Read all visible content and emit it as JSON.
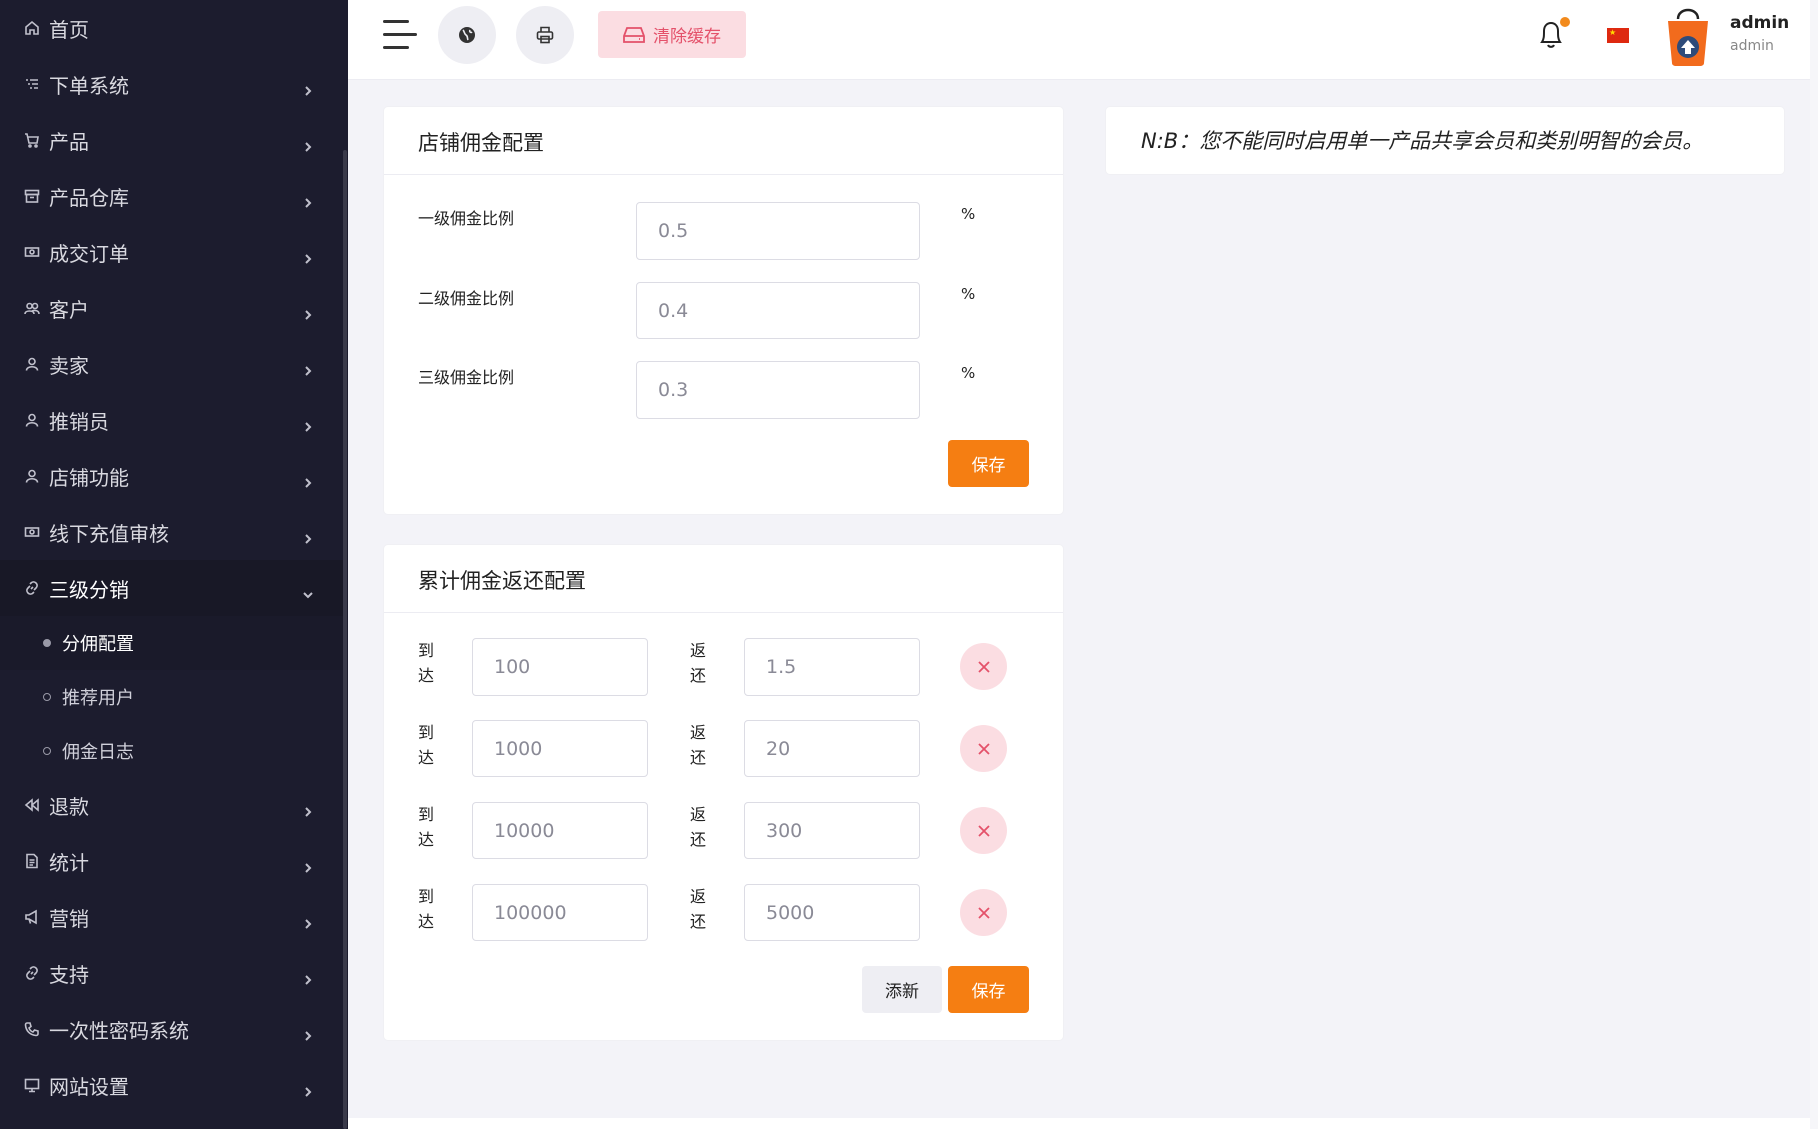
{
  "sidebar": {
    "items": [
      {
        "label": "首页",
        "icon": "home-icon",
        "has_chevron": false
      },
      {
        "label": "下单系统",
        "icon": "list-icon",
        "has_chevron": true
      },
      {
        "label": "产品",
        "icon": "cart-icon",
        "has_chevron": true
      },
      {
        "label": "产品仓库",
        "icon": "archive-icon",
        "has_chevron": true
      },
      {
        "label": "成交订单",
        "icon": "money-icon",
        "has_chevron": true
      },
      {
        "label": "客户",
        "icon": "users-icon",
        "has_chevron": true
      },
      {
        "label": "卖家",
        "icon": "user-icon",
        "has_chevron": true
      },
      {
        "label": "推销员",
        "icon": "user-icon",
        "has_chevron": true
      },
      {
        "label": "店铺功能",
        "icon": "user-icon",
        "has_chevron": true
      },
      {
        "label": "线下充值审核",
        "icon": "money-icon",
        "has_chevron": true
      },
      {
        "label": "三级分销",
        "icon": "link-icon",
        "has_chevron": true,
        "expanded": true
      }
    ],
    "sub_items": [
      {
        "label": "分佣配置",
        "active": true
      },
      {
        "label": "推荐用户",
        "active": false
      },
      {
        "label": "佣金日志",
        "active": false
      }
    ],
    "items_after": [
      {
        "label": "退款",
        "icon": "rewind-icon"
      },
      {
        "label": "统计",
        "icon": "document-icon"
      },
      {
        "label": "营销",
        "icon": "megaphone-icon"
      },
      {
        "label": "支持",
        "icon": "link-icon"
      },
      {
        "label": "一次性密码系统",
        "icon": "phone-icon"
      },
      {
        "label": "网站设置",
        "icon": "monitor-icon"
      }
    ]
  },
  "header": {
    "clear_cache_label": "清除缓存",
    "user_name": "admin",
    "user_role": "admin",
    "notification_dot_color": "#f28a1c"
  },
  "commission_card": {
    "title": "店铺佣金配置",
    "rows": [
      {
        "label": "一级佣金比例",
        "value": "0.5",
        "unit": "%"
      },
      {
        "label": "二级佣金比例",
        "value": "0.4",
        "unit": "%"
      },
      {
        "label": "三级佣金比例",
        "value": "0.3",
        "unit": "%"
      }
    ],
    "save_label": "保存"
  },
  "cumulative_card": {
    "title": "累计佣金返还配置",
    "reach_label": [
      "到",
      "达"
    ],
    "return_label": [
      "返",
      "还"
    ],
    "rows": [
      {
        "reach": "100",
        "ret": "1.5"
      },
      {
        "reach": "1000",
        "ret": "20"
      },
      {
        "reach": "10000",
        "ret": "300"
      },
      {
        "reach": "100000",
        "ret": "5000"
      }
    ],
    "add_label": "添新",
    "save_label": "保存"
  },
  "note": {
    "text": "N:B：您不能同时启用单一产品共享会员和类别明智的会员。"
  },
  "colors": {
    "accent": "#f57e12",
    "danger": "#e4516a",
    "danger_bg": "#fbdde2",
    "sidebar_bg": "#1c1c2e"
  }
}
